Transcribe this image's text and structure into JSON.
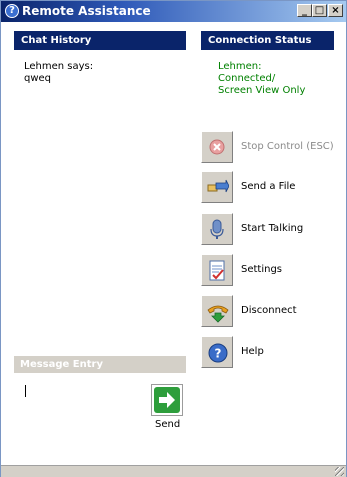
{
  "window": {
    "title": "Remote Assistance",
    "controls": {
      "minimize": "_",
      "maximize": "□",
      "close": "×"
    }
  },
  "chat": {
    "header": "Chat History",
    "sender_line": "Lehmen says:",
    "message": "qweq"
  },
  "connection": {
    "header": "Connection Status",
    "status_lines": [
      "Lehmen:",
      "Connected/",
      "Screen View Only"
    ]
  },
  "actions": [
    {
      "label": "Stop Control (ESC)",
      "icon": "stop-icon",
      "enabled": false
    },
    {
      "label": "Send a File",
      "icon": "send-file-icon",
      "enabled": true
    },
    {
      "label": "Start Talking",
      "icon": "microphone-icon",
      "enabled": true
    },
    {
      "label": "Settings",
      "icon": "settings-icon",
      "enabled": true
    },
    {
      "label": "Disconnect",
      "icon": "disconnect-phone-icon",
      "enabled": true
    },
    {
      "label": "Help",
      "icon": "help-icon",
      "enabled": true
    }
  ],
  "message_entry": {
    "header": "Message Entry",
    "value": ""
  },
  "send": {
    "label": "Send",
    "icon": "arrow-right-icon"
  },
  "colors": {
    "header_bg": "#0a246a",
    "status_text": "#008000",
    "send_green": "#2e9e3c",
    "disabled_text": "#8a8a8a"
  }
}
